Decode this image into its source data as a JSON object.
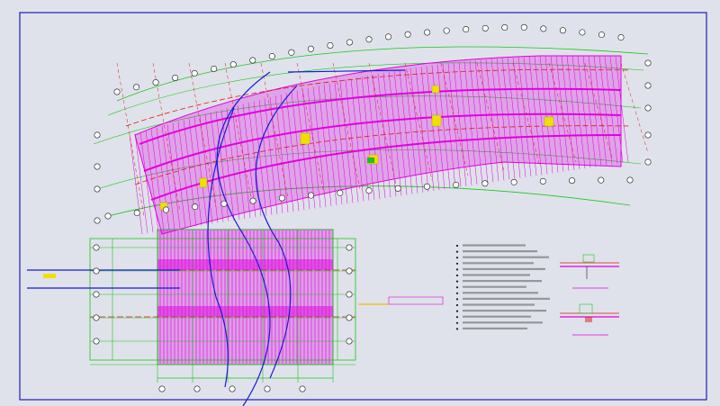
{
  "drawing": {
    "type": "structural floor plan (CAD)",
    "background_color": "#dfe2ea",
    "colors": {
      "border": "#1f1fb4",
      "grid": "#19c619",
      "beam": "#e000e0",
      "axis": "#e11818",
      "pipe": "#1a1ad8",
      "highlight": "#f0e000",
      "bubble": "#1a1a1a"
    }
  },
  "notes": {
    "lines": [
      "",
      "",
      "",
      "",
      "",
      "",
      "",
      "",
      "",
      "",
      "",
      "",
      "",
      "",
      ""
    ]
  },
  "sections": [
    {
      "name": "section-detail-1",
      "title": ""
    },
    {
      "name": "section-detail-2",
      "title": ""
    }
  ],
  "labels": {
    "center_tag": "",
    "left_marker": "",
    "mid_marker": ""
  }
}
